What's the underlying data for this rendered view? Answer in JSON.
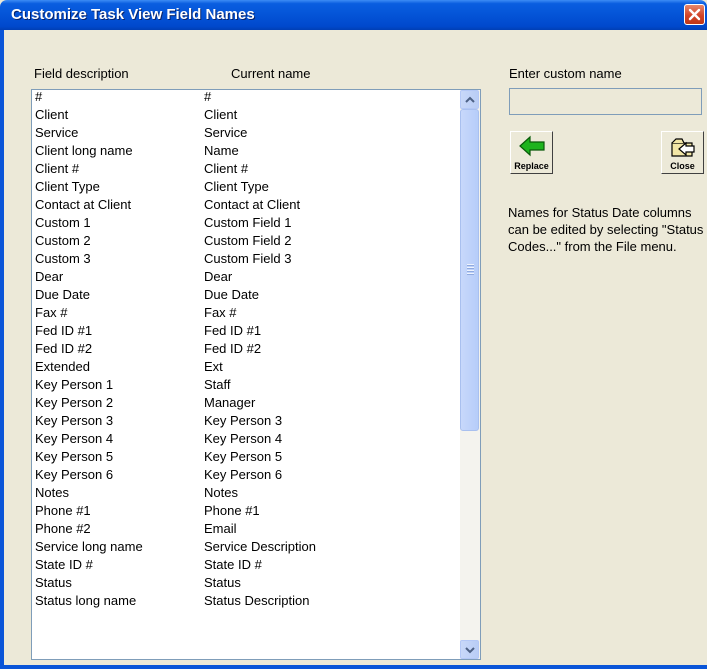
{
  "window": {
    "title": "Customize Task View Field Names"
  },
  "headers": {
    "field_description": "Field description",
    "current_name": "Current name",
    "enter_custom_name": "Enter custom name"
  },
  "custom_name": {
    "value": ""
  },
  "buttons": {
    "replace": "Replace",
    "close": "Close"
  },
  "note": "Names for Status Date columns can be edited by selecting \"Status Codes...\" from the File menu.",
  "colors": {
    "title_bar": "#0454d7",
    "dialog_bg": "#ece9d8",
    "close_button": "#d2452a",
    "replace_arrow": "#1eb31e"
  },
  "rows": [
    {
      "field": "#",
      "current": "#"
    },
    {
      "field": "Client",
      "current": "Client"
    },
    {
      "field": "Service",
      "current": "Service"
    },
    {
      "field": "Client long name",
      "current": "Name"
    },
    {
      "field": "Client #",
      "current": "Client #"
    },
    {
      "field": "Client Type",
      "current": "Client Type"
    },
    {
      "field": "Contact at Client",
      "current": "Contact at Client"
    },
    {
      "field": "Custom 1",
      "current": "Custom Field 1"
    },
    {
      "field": "Custom 2",
      "current": "Custom Field 2"
    },
    {
      "field": "Custom 3",
      "current": "Custom Field 3"
    },
    {
      "field": "Dear",
      "current": "Dear"
    },
    {
      "field": "Due Date",
      "current": "Due Date"
    },
    {
      "field": "Fax #",
      "current": "Fax #"
    },
    {
      "field": "Fed ID #1",
      "current": "Fed ID #1"
    },
    {
      "field": "Fed ID #2",
      "current": "Fed ID #2"
    },
    {
      "field": "Extended",
      "current": "Ext"
    },
    {
      "field": "Key Person 1",
      "current": "Staff"
    },
    {
      "field": "Key Person 2",
      "current": "Manager"
    },
    {
      "field": "Key Person 3",
      "current": "Key Person 3"
    },
    {
      "field": "Key Person 4",
      "current": "Key Person 4"
    },
    {
      "field": "Key Person 5",
      "current": "Key Person 5"
    },
    {
      "field": "Key Person 6",
      "current": "Key Person 6"
    },
    {
      "field": "Notes",
      "current": "Notes"
    },
    {
      "field": "Phone #1",
      "current": "Phone #1"
    },
    {
      "field": "Phone #2",
      "current": "Email"
    },
    {
      "field": "Service long name",
      "current": "Service Description"
    },
    {
      "field": "State ID #",
      "current": "State ID #"
    },
    {
      "field": "Status",
      "current": "Status"
    },
    {
      "field": "Status long name",
      "current": "Status Description"
    }
  ],
  "icons": {
    "close": "close-x-icon",
    "scroll_up": "chevron-up-icon",
    "scroll_down": "chevron-down-icon",
    "replace": "green-arrow-left-icon",
    "close_folder": "folder-exit-icon"
  }
}
